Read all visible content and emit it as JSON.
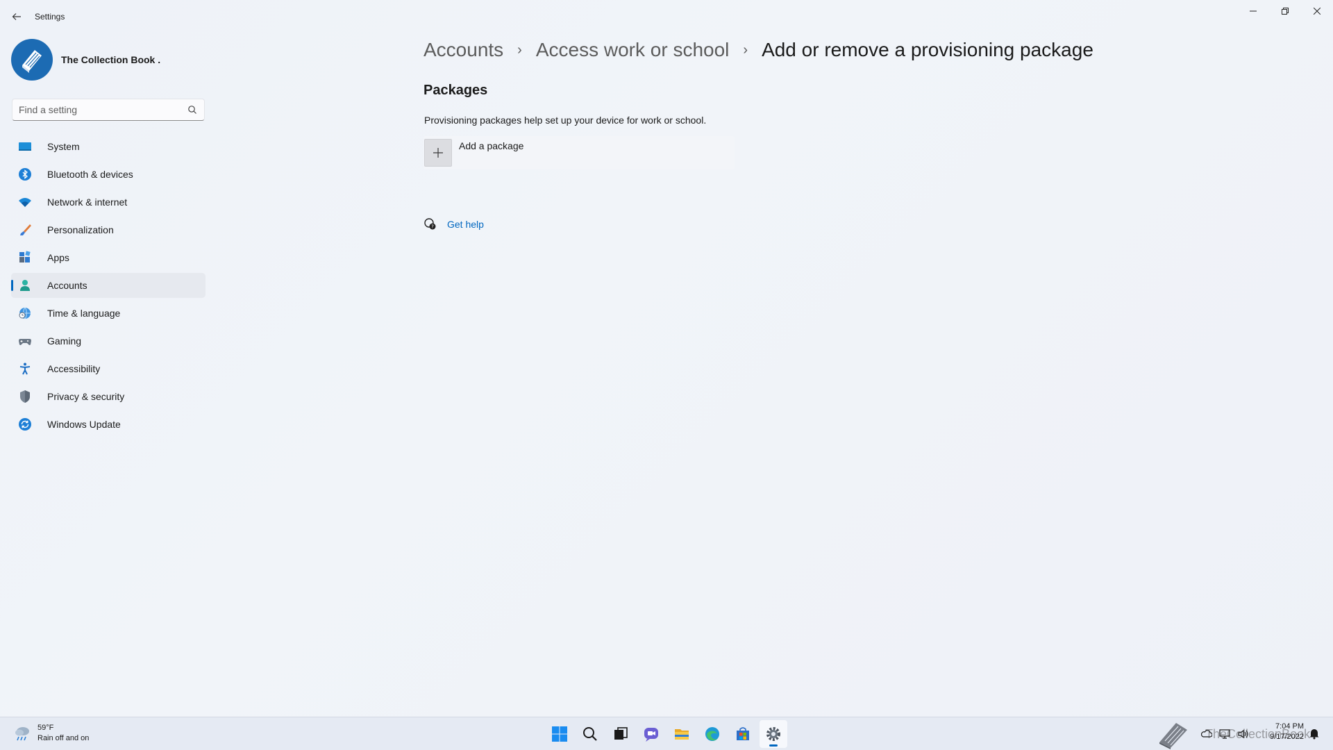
{
  "window": {
    "title": "Settings"
  },
  "profile": {
    "name": "The Collection Book ."
  },
  "search": {
    "placeholder": "Find a setting"
  },
  "sidebar": {
    "items": [
      {
        "label": "System",
        "icon": "system-icon"
      },
      {
        "label": "Bluetooth & devices",
        "icon": "bluetooth-icon"
      },
      {
        "label": "Network & internet",
        "icon": "wifi-icon"
      },
      {
        "label": "Personalization",
        "icon": "brush-icon"
      },
      {
        "label": "Apps",
        "icon": "apps-icon"
      },
      {
        "label": "Accounts",
        "icon": "person-icon",
        "active": true
      },
      {
        "label": "Time & language",
        "icon": "globe-clock-icon"
      },
      {
        "label": "Gaming",
        "icon": "gamepad-icon"
      },
      {
        "label": "Accessibility",
        "icon": "accessibility-icon"
      },
      {
        "label": "Privacy & security",
        "icon": "shield-icon"
      },
      {
        "label": "Windows Update",
        "icon": "update-icon"
      }
    ]
  },
  "breadcrumb": {
    "items": [
      "Accounts",
      "Access work or school"
    ],
    "current": "Add or remove a provisioning package"
  },
  "packages": {
    "title": "Packages",
    "description": "Provisioning packages help set up your device for work or school.",
    "add_label": "Add a package"
  },
  "help": {
    "label": "Get help"
  },
  "taskbar": {
    "weather_temp": "59°F",
    "weather_desc": "Rain off and on",
    "watermark": "TheCollectionBook",
    "time": "7:04 PM",
    "date": "9/17/2022",
    "apps": [
      "start-icon",
      "search-icon",
      "task-view-icon",
      "chat-icon",
      "file-explorer-icon",
      "edge-icon",
      "store-icon",
      "settings-icon"
    ]
  },
  "colors": {
    "accent": "#0067c0",
    "background": "#eef2f8",
    "active_nav": "#e6e9ef"
  }
}
